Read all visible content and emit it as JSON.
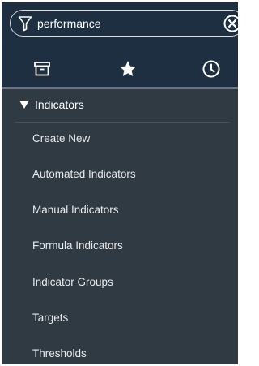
{
  "search": {
    "value": "performance",
    "icon": "filter-icon",
    "clear_icon": "clear-circle-icon"
  },
  "tabs": [
    {
      "icon": "archive-icon"
    },
    {
      "icon": "star-icon"
    },
    {
      "icon": "clock-icon"
    }
  ],
  "section": {
    "label": "Indicators",
    "expanded": true
  },
  "menu": {
    "items": [
      {
        "label": "Create New"
      },
      {
        "label": "Automated Indicators"
      },
      {
        "label": "Manual Indicators"
      },
      {
        "label": "Formula Indicators"
      },
      {
        "label": "Indicator Groups"
      },
      {
        "label": "Targets"
      },
      {
        "label": "Thresholds"
      }
    ]
  },
  "colors": {
    "header_bg": "#1d2f40",
    "panel_bg": "#303a42",
    "text": "#ffffff"
  }
}
